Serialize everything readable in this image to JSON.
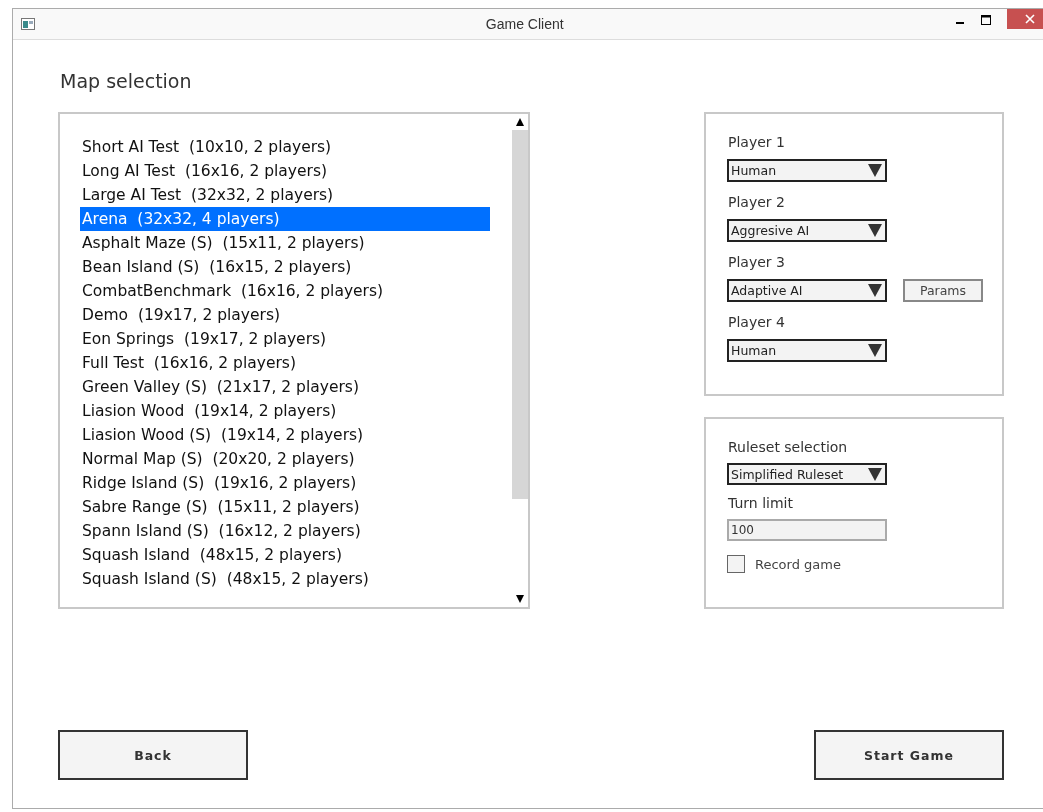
{
  "window": {
    "title": "Game Client"
  },
  "map_selection": {
    "title": "Map selection",
    "maps": [
      {
        "label": "Short AI Test  (10x10, 2 players)",
        "selected": false
      },
      {
        "label": "Long AI Test  (16x16, 2 players)",
        "selected": false
      },
      {
        "label": "Large AI Test  (32x32, 2 players)",
        "selected": false
      },
      {
        "label": "Arena  (32x32, 4 players)",
        "selected": true
      },
      {
        "label": "Asphalt Maze (S)  (15x11, 2 players)",
        "selected": false
      },
      {
        "label": "Bean Island (S)  (16x15, 2 players)",
        "selected": false
      },
      {
        "label": "CombatBenchmark  (16x16, 2 players)",
        "selected": false
      },
      {
        "label": "Demo  (19x17, 2 players)",
        "selected": false
      },
      {
        "label": "Eon Springs  (19x17, 2 players)",
        "selected": false
      },
      {
        "label": "Full Test  (16x16, 2 players)",
        "selected": false
      },
      {
        "label": "Green Valley (S)  (21x17, 2 players)",
        "selected": false
      },
      {
        "label": "Liasion Wood  (19x14, 2 players)",
        "selected": false
      },
      {
        "label": "Liasion Wood (S)  (19x14, 2 players)",
        "selected": false
      },
      {
        "label": "Normal Map (S)  (20x20, 2 players)",
        "selected": false
      },
      {
        "label": "Ridge Island (S)  (19x16, 2 players)",
        "selected": false
      },
      {
        "label": "Sabre Range (S)  (15x11, 2 players)",
        "selected": false
      },
      {
        "label": "Spann Island (S)  (16x12, 2 players)",
        "selected": false
      },
      {
        "label": "Squash Island  (48x15, 2 players)",
        "selected": false
      },
      {
        "label": "Squash Island (S)  (48x15, 2 players)",
        "selected": false
      }
    ]
  },
  "players": [
    {
      "label": "Player 1",
      "value": "Human"
    },
    {
      "label": "Player 2",
      "value": "Aggresive AI"
    },
    {
      "label": "Player 3",
      "value": "Adaptive AI",
      "button": "Params"
    },
    {
      "label": "Player 4",
      "value": "Human"
    }
  ],
  "settings": {
    "ruleset_label": "Ruleset selection",
    "ruleset_value": "Simplified Ruleset",
    "turn_limit_label": "Turn limit",
    "turn_limit_value": "100",
    "record_label": "Record game",
    "record_checked": false
  },
  "buttons": {
    "back": "Back",
    "start": "Start Game"
  }
}
